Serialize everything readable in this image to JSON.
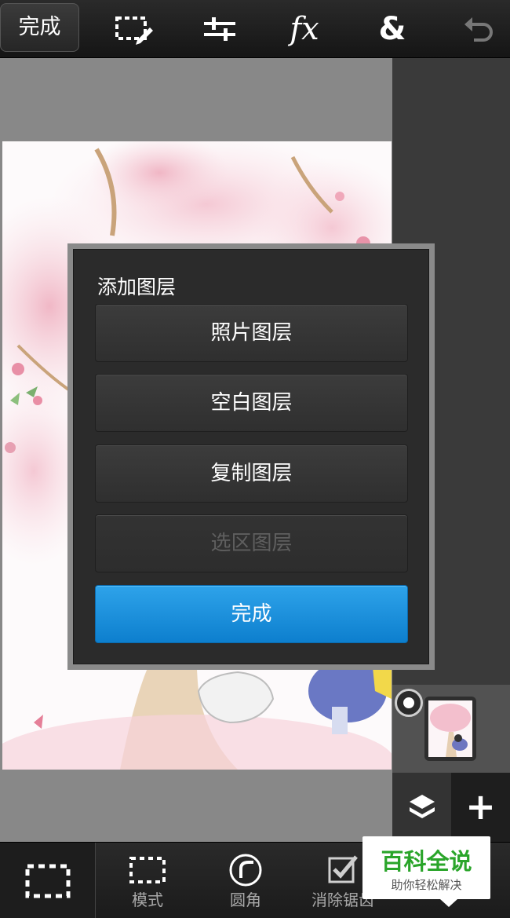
{
  "toolbar": {
    "done_label": "完成",
    "icons": [
      "selection-edit-icon",
      "adjust-sliders-icon",
      "fx-icon",
      "blend-icon",
      "undo-icon"
    ],
    "fx_label": "fx",
    "blend_label": "&"
  },
  "dialog": {
    "title": "添加图层",
    "buttons": [
      {
        "label": "照片图层",
        "enabled": true
      },
      {
        "label": "空白图层",
        "enabled": true
      },
      {
        "label": "复制图层",
        "enabled": true
      },
      {
        "label": "选区图层",
        "enabled": false
      }
    ],
    "done_label": "完成",
    "accent_color": "#1b8fdc"
  },
  "layers": {
    "add_label": "+"
  },
  "bottombar": {
    "tools": [
      {
        "label": "模式",
        "icon": "dashed-rect-icon"
      },
      {
        "label": "圆角",
        "icon": "round-corner-icon"
      },
      {
        "label": "消除锯齿",
        "icon": "checkbox-icon"
      }
    ]
  },
  "watermark": {
    "main": "百科全说",
    "sub": "助你轻松解决"
  }
}
